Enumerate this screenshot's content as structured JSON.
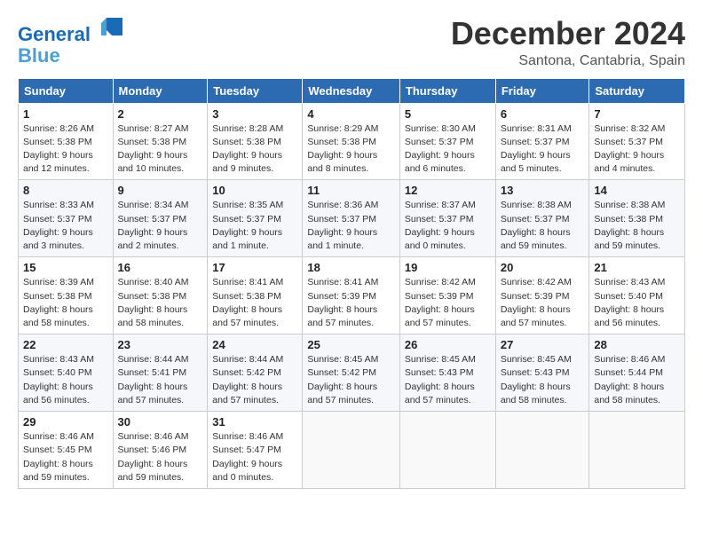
{
  "header": {
    "logo_line1": "General",
    "logo_line2": "Blue",
    "month": "December 2024",
    "location": "Santona, Cantabria, Spain"
  },
  "weekdays": [
    "Sunday",
    "Monday",
    "Tuesday",
    "Wednesday",
    "Thursday",
    "Friday",
    "Saturday"
  ],
  "weeks": [
    [
      {
        "day": "1",
        "info": "Sunrise: 8:26 AM\nSunset: 5:38 PM\nDaylight: 9 hours and 12 minutes."
      },
      {
        "day": "2",
        "info": "Sunrise: 8:27 AM\nSunset: 5:38 PM\nDaylight: 9 hours and 10 minutes."
      },
      {
        "day": "3",
        "info": "Sunrise: 8:28 AM\nSunset: 5:38 PM\nDaylight: 9 hours and 9 minutes."
      },
      {
        "day": "4",
        "info": "Sunrise: 8:29 AM\nSunset: 5:38 PM\nDaylight: 9 hours and 8 minutes."
      },
      {
        "day": "5",
        "info": "Sunrise: 8:30 AM\nSunset: 5:37 PM\nDaylight: 9 hours and 6 minutes."
      },
      {
        "day": "6",
        "info": "Sunrise: 8:31 AM\nSunset: 5:37 PM\nDaylight: 9 hours and 5 minutes."
      },
      {
        "day": "7",
        "info": "Sunrise: 8:32 AM\nSunset: 5:37 PM\nDaylight: 9 hours and 4 minutes."
      }
    ],
    [
      {
        "day": "8",
        "info": "Sunrise: 8:33 AM\nSunset: 5:37 PM\nDaylight: 9 hours and 3 minutes."
      },
      {
        "day": "9",
        "info": "Sunrise: 8:34 AM\nSunset: 5:37 PM\nDaylight: 9 hours and 2 minutes."
      },
      {
        "day": "10",
        "info": "Sunrise: 8:35 AM\nSunset: 5:37 PM\nDaylight: 9 hours and 1 minute."
      },
      {
        "day": "11",
        "info": "Sunrise: 8:36 AM\nSunset: 5:37 PM\nDaylight: 9 hours and 1 minute."
      },
      {
        "day": "12",
        "info": "Sunrise: 8:37 AM\nSunset: 5:37 PM\nDaylight: 9 hours and 0 minutes."
      },
      {
        "day": "13",
        "info": "Sunrise: 8:38 AM\nSunset: 5:37 PM\nDaylight: 8 hours and 59 minutes."
      },
      {
        "day": "14",
        "info": "Sunrise: 8:38 AM\nSunset: 5:38 PM\nDaylight: 8 hours and 59 minutes."
      }
    ],
    [
      {
        "day": "15",
        "info": "Sunrise: 8:39 AM\nSunset: 5:38 PM\nDaylight: 8 hours and 58 minutes."
      },
      {
        "day": "16",
        "info": "Sunrise: 8:40 AM\nSunset: 5:38 PM\nDaylight: 8 hours and 58 minutes."
      },
      {
        "day": "17",
        "info": "Sunrise: 8:41 AM\nSunset: 5:38 PM\nDaylight: 8 hours and 57 minutes."
      },
      {
        "day": "18",
        "info": "Sunrise: 8:41 AM\nSunset: 5:39 PM\nDaylight: 8 hours and 57 minutes."
      },
      {
        "day": "19",
        "info": "Sunrise: 8:42 AM\nSunset: 5:39 PM\nDaylight: 8 hours and 57 minutes."
      },
      {
        "day": "20",
        "info": "Sunrise: 8:42 AM\nSunset: 5:39 PM\nDaylight: 8 hours and 57 minutes."
      },
      {
        "day": "21",
        "info": "Sunrise: 8:43 AM\nSunset: 5:40 PM\nDaylight: 8 hours and 56 minutes."
      }
    ],
    [
      {
        "day": "22",
        "info": "Sunrise: 8:43 AM\nSunset: 5:40 PM\nDaylight: 8 hours and 56 minutes."
      },
      {
        "day": "23",
        "info": "Sunrise: 8:44 AM\nSunset: 5:41 PM\nDaylight: 8 hours and 57 minutes."
      },
      {
        "day": "24",
        "info": "Sunrise: 8:44 AM\nSunset: 5:42 PM\nDaylight: 8 hours and 57 minutes."
      },
      {
        "day": "25",
        "info": "Sunrise: 8:45 AM\nSunset: 5:42 PM\nDaylight: 8 hours and 57 minutes."
      },
      {
        "day": "26",
        "info": "Sunrise: 8:45 AM\nSunset: 5:43 PM\nDaylight: 8 hours and 57 minutes."
      },
      {
        "day": "27",
        "info": "Sunrise: 8:45 AM\nSunset: 5:43 PM\nDaylight: 8 hours and 58 minutes."
      },
      {
        "day": "28",
        "info": "Sunrise: 8:46 AM\nSunset: 5:44 PM\nDaylight: 8 hours and 58 minutes."
      }
    ],
    [
      {
        "day": "29",
        "info": "Sunrise: 8:46 AM\nSunset: 5:45 PM\nDaylight: 8 hours and 59 minutes."
      },
      {
        "day": "30",
        "info": "Sunrise: 8:46 AM\nSunset: 5:46 PM\nDaylight: 8 hours and 59 minutes."
      },
      {
        "day": "31",
        "info": "Sunrise: 8:46 AM\nSunset: 5:47 PM\nDaylight: 9 hours and 0 minutes."
      },
      null,
      null,
      null,
      null
    ]
  ]
}
